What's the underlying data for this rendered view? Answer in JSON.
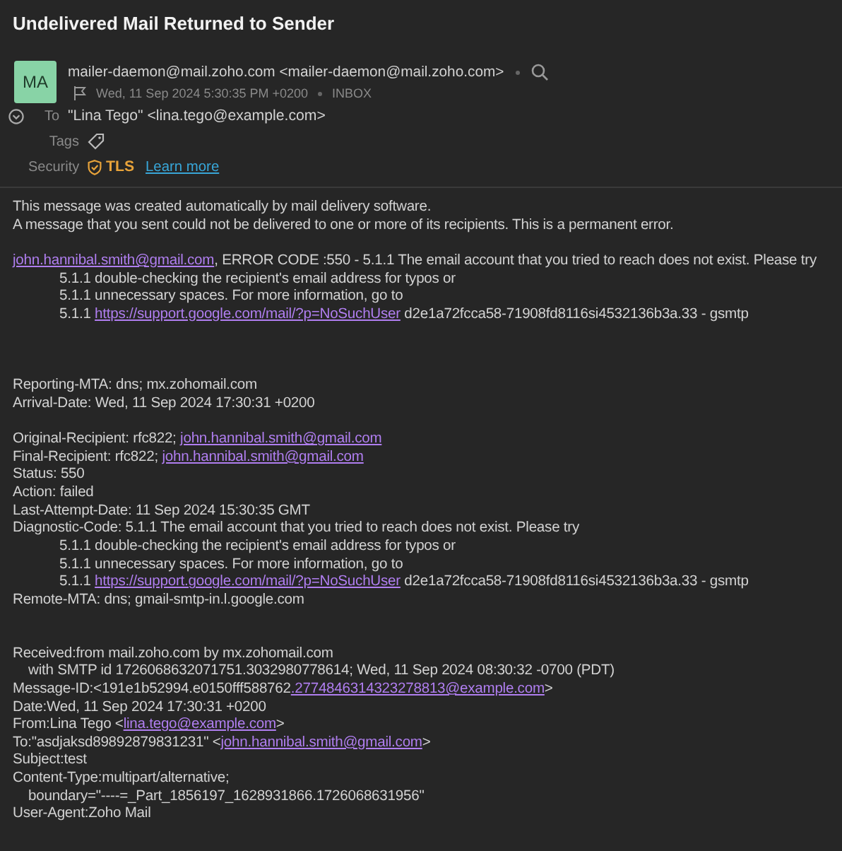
{
  "subject": "Undelivered Mail Returned to Sender",
  "sender": {
    "initials": "MA",
    "from": "mailer-daemon@mail.zoho.com <mailer-daemon@mail.zoho.com>",
    "date": "Wed, 11 Sep 2024 5:30:35 PM +0200",
    "folder": "INBOX",
    "flagged": false
  },
  "fields": [
    {
      "kind": "to",
      "label": "To",
      "value": "\"Lina Tego\" <lina.tego@example.com>"
    },
    {
      "kind": "tags",
      "label": "Tags"
    },
    {
      "kind": "security",
      "label": "Security",
      "value": "TLS",
      "link": "Learn more"
    }
  ],
  "body": [
    {
      "kind": "line",
      "parts": [
        {
          "kind": "text",
          "text": "This message was created automatically by mail delivery software."
        }
      ]
    },
    {
      "kind": "line",
      "parts": [
        {
          "kind": "text",
          "text": "A message that you sent could not be delivered to one or more of its recipients. This is a permanent error."
        }
      ]
    },
    {
      "kind": "blank"
    },
    {
      "kind": "line",
      "parts": [
        {
          "kind": "link",
          "text": "john.hannibal.smith@gmail.com"
        },
        {
          "kind": "text",
          "text": ", ERROR CODE :550 - 5.1.1 The email account that you tried to reach does not exist. Please try"
        }
      ]
    },
    {
      "kind": "indent",
      "parts": [
        {
          "kind": "text",
          "text": "5.1.1 double-checking the recipient's email address for typos or"
        }
      ]
    },
    {
      "kind": "indent",
      "parts": [
        {
          "kind": "text",
          "text": "5.1.1 unnecessary spaces. For more information, go to"
        }
      ]
    },
    {
      "kind": "indent",
      "parts": [
        {
          "kind": "text",
          "text": "5.1.1 "
        },
        {
          "kind": "link",
          "text": "https://support.google.com/mail/?p=NoSuchUser"
        },
        {
          "kind": "text",
          "text": " d2e1a72fcca58-71908fd8116si4532136b3a.33 - gsmtp"
        }
      ]
    },
    {
      "kind": "blank"
    },
    {
      "kind": "blank"
    },
    {
      "kind": "blank"
    },
    {
      "kind": "line",
      "parts": [
        {
          "kind": "text",
          "text": "Reporting-MTA: dns; mx.zohomail.com"
        }
      ]
    },
    {
      "kind": "line",
      "parts": [
        {
          "kind": "text",
          "text": "Arrival-Date: Wed, 11 Sep 2024 17:30:31 +0200"
        }
      ]
    },
    {
      "kind": "blank"
    },
    {
      "kind": "line",
      "parts": [
        {
          "kind": "text",
          "text": "Original-Recipient: rfc822; "
        },
        {
          "kind": "link",
          "text": "john.hannibal.smith@gmail.com"
        }
      ]
    },
    {
      "kind": "line",
      "parts": [
        {
          "kind": "text",
          "text": "Final-Recipient: rfc822; "
        },
        {
          "kind": "link",
          "text": "john.hannibal.smith@gmail.com"
        }
      ]
    },
    {
      "kind": "line",
      "parts": [
        {
          "kind": "text",
          "text": "Status: 550"
        }
      ]
    },
    {
      "kind": "line",
      "parts": [
        {
          "kind": "text",
          "text": "Action: failed"
        }
      ]
    },
    {
      "kind": "line",
      "parts": [
        {
          "kind": "text",
          "text": "Last-Attempt-Date: 11 Sep 2024 15:30:35 GMT"
        }
      ]
    },
    {
      "kind": "line",
      "parts": [
        {
          "kind": "text",
          "text": "Diagnostic-Code: 5.1.1 The email account that you tried to reach does not exist. Please try"
        }
      ]
    },
    {
      "kind": "indent",
      "parts": [
        {
          "kind": "text",
          "text": "5.1.1 double-checking the recipient's email address for typos or"
        }
      ]
    },
    {
      "kind": "indent",
      "parts": [
        {
          "kind": "text",
          "text": "5.1.1 unnecessary spaces. For more information, go to"
        }
      ]
    },
    {
      "kind": "indent",
      "parts": [
        {
          "kind": "text",
          "text": "5.1.1 "
        },
        {
          "kind": "link",
          "text": "https://support.google.com/mail/?p=NoSuchUser"
        },
        {
          "kind": "text",
          "text": " d2e1a72fcca58-71908fd8116si4532136b3a.33 - gsmtp"
        }
      ]
    },
    {
      "kind": "line",
      "parts": [
        {
          "kind": "text",
          "text": "Remote-MTA: dns; gmail-smtp-in.l.google.com"
        }
      ]
    },
    {
      "kind": "blank"
    },
    {
      "kind": "blank"
    },
    {
      "kind": "line",
      "parts": [
        {
          "kind": "text",
          "text": "Received:from mail.zoho.com by mx.zohomail.com"
        }
      ]
    },
    {
      "kind": "small-indent",
      "parts": [
        {
          "kind": "text",
          "text": "with SMTP id 1726068632071751.3032980778614; Wed, 11 Sep 2024 08:30:32 -0700 (PDT)"
        }
      ]
    },
    {
      "kind": "line",
      "parts": [
        {
          "kind": "text",
          "text": "Message-ID:<191e1b52994.e0150fff588762"
        },
        {
          "kind": "link",
          "text": ".2774846314323278813@example.com"
        },
        {
          "kind": "text",
          "text": ">"
        }
      ]
    },
    {
      "kind": "line",
      "parts": [
        {
          "kind": "text",
          "text": "Date:Wed, 11 Sep 2024 17:30:31 +0200"
        }
      ]
    },
    {
      "kind": "line",
      "parts": [
        {
          "kind": "text",
          "text": "From:Lina Tego <"
        },
        {
          "kind": "link",
          "text": "lina.tego@example.com"
        },
        {
          "kind": "text",
          "text": ">"
        }
      ]
    },
    {
      "kind": "line",
      "parts": [
        {
          "kind": "text",
          "text": "To:\"asdjaksd89892879831231\" <"
        },
        {
          "kind": "link",
          "text": "john.hannibal.smith@gmail.com"
        },
        {
          "kind": "text",
          "text": ">"
        }
      ]
    },
    {
      "kind": "line",
      "parts": [
        {
          "kind": "text",
          "text": "Subject:test"
        }
      ]
    },
    {
      "kind": "line",
      "parts": [
        {
          "kind": "text",
          "text": "Content-Type:multipart/alternative;"
        }
      ]
    },
    {
      "kind": "small-indent",
      "parts": [
        {
          "kind": "text",
          "text": "boundary=\"----=_Part_1856197_1628931866.1726068631956\""
        }
      ]
    },
    {
      "kind": "line",
      "parts": [
        {
          "kind": "text",
          "text": "User-Agent:Zoho Mail"
        }
      ]
    }
  ]
}
